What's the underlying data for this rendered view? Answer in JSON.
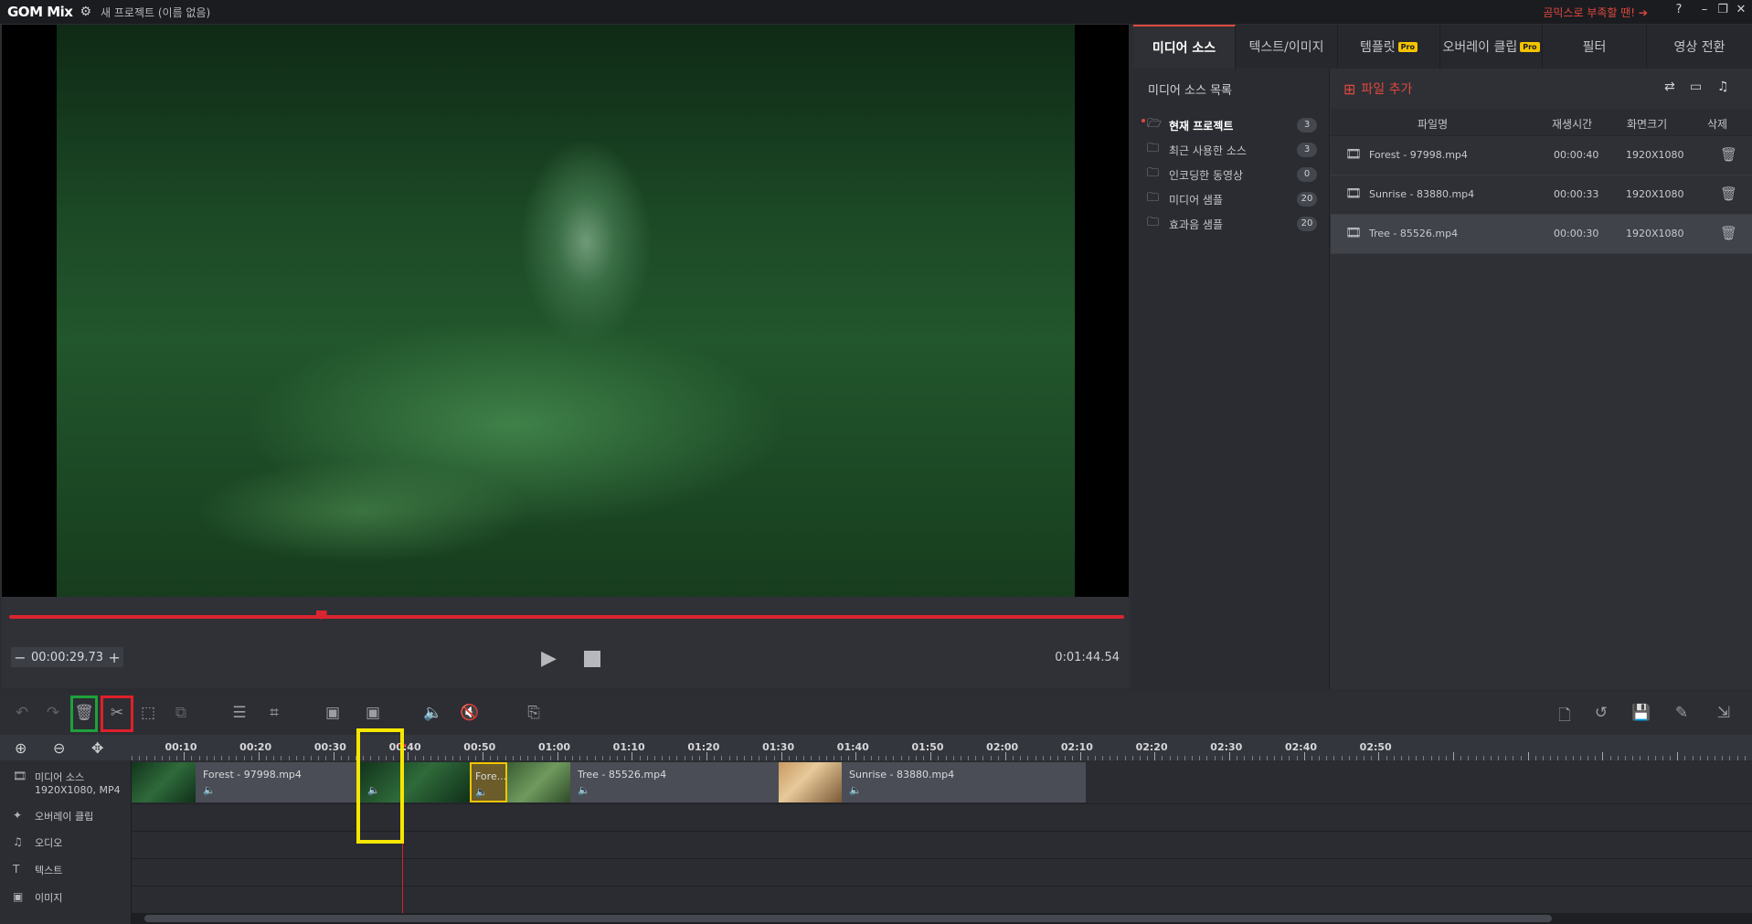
{
  "app": {
    "logo": "GOM Mix",
    "project_title": "새 프로젝트 (이름 없음)",
    "promo": "곰믹스로 부족할 땐! ➔",
    "help": "?",
    "minimize": "–",
    "restore": "❐",
    "close": "✕"
  },
  "preview": {
    "current_time": "00:00:29.73",
    "total_time": "0:01:44.54",
    "minus": "−",
    "plus": "+",
    "play": "▶",
    "progress_fraction": 0.28
  },
  "tabs": [
    {
      "label": "미디어 소스"
    },
    {
      "label": "텍스트/이미지"
    },
    {
      "label": "템플릿",
      "badge": "Pro"
    },
    {
      "label": "오버레이 클립",
      "badge": "Pro"
    },
    {
      "label": "필터"
    },
    {
      "label": "영상 전환"
    }
  ],
  "sources": {
    "title": "미디어 소스 목록",
    "items": [
      {
        "label": "현재 프로젝트",
        "count": "3",
        "icon": "folder-open-icon"
      },
      {
        "label": "최근 사용한 소스",
        "count": "3",
        "icon": "folder-icon"
      },
      {
        "label": "인코딩한 동영상",
        "count": "0",
        "icon": "folder-export-icon"
      },
      {
        "label": "미디어 샘플",
        "count": "20",
        "icon": "folder-icon"
      },
      {
        "label": "효과음 샘플",
        "count": "20",
        "icon": "folder-icon"
      }
    ]
  },
  "files": {
    "add_label": "파일 추가",
    "columns": {
      "name": "파일명",
      "duration": "재생시간",
      "resolution": "화면크기",
      "delete": "삭제"
    },
    "rows": [
      {
        "name": "Forest - 97998.mp4",
        "duration": "00:00:40",
        "resolution": "1920X1080"
      },
      {
        "name": "Sunrise - 83880.mp4",
        "duration": "00:00:33",
        "resolution": "1920X1080"
      },
      {
        "name": "Tree - 85526.mp4",
        "duration": "00:00:30",
        "resolution": "1920X1080"
      }
    ]
  },
  "timeline": {
    "ticks": [
      "00:10",
      "00:20",
      "00:30",
      "00:40",
      "00:50",
      "01:00",
      "01:10",
      "01:20",
      "01:30",
      "01:40",
      "01:50",
      "02:00",
      "02:10",
      "02:20",
      "02:30",
      "02:40",
      "02:50"
    ],
    "tracks": [
      {
        "label": "미디어 소스",
        "sub": "1920X1080, MP4",
        "icon": "film-icon"
      },
      {
        "label": "오버레이 클립",
        "icon": "overlay-icon"
      },
      {
        "label": "오디오",
        "icon": "music-icon"
      },
      {
        "label": "텍스트",
        "icon": "text-icon"
      },
      {
        "label": "이미지",
        "icon": "image-icon"
      }
    ],
    "clips": [
      {
        "name": "Forest - 97998.mp4"
      },
      {
        "name": "Fore..."
      },
      {
        "name": "Tree - 85526.mp4"
      },
      {
        "name": "Sunrise - 83880.mp4"
      }
    ]
  },
  "colors": {
    "accent": "#e0483e",
    "selection": "#f3c400",
    "highlight_green": "#1fa03a",
    "highlight_red": "#e0202a",
    "highlight_yellow": "#f6e600"
  }
}
